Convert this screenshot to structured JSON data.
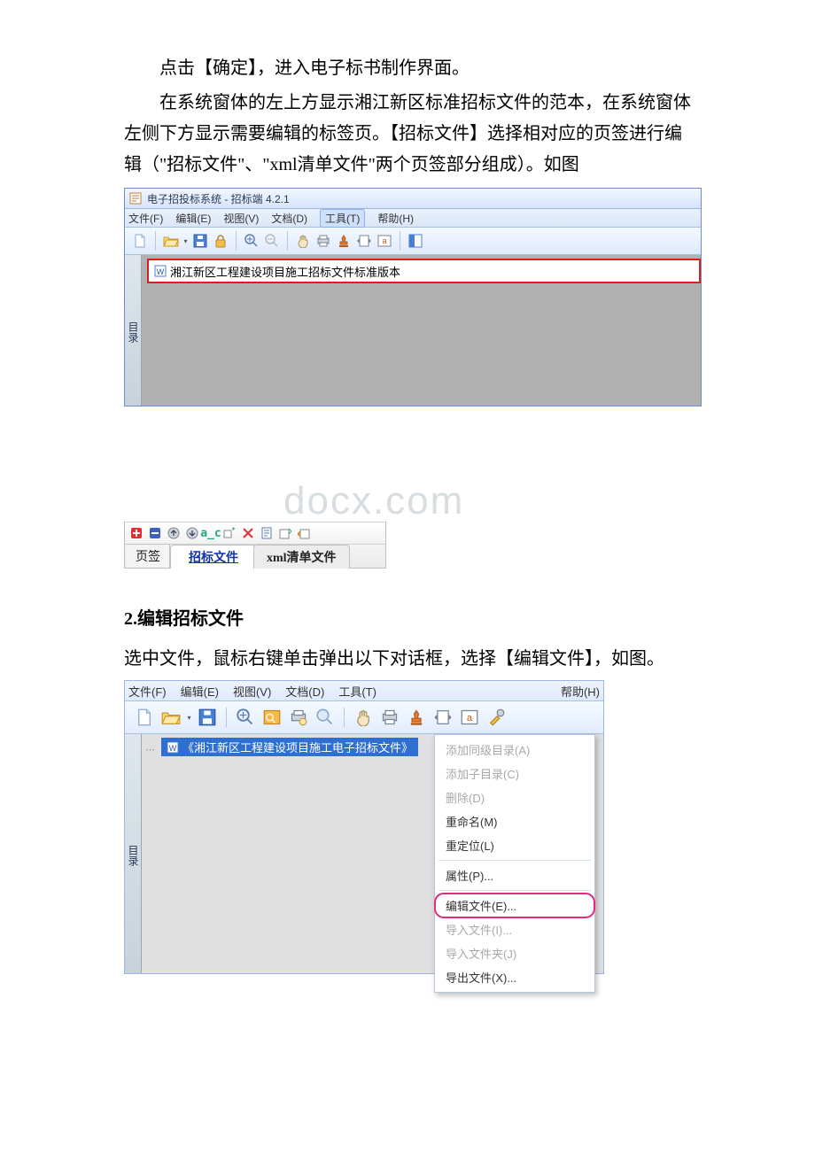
{
  "body": {
    "p1": "点击【确定】，进入电子标书制作界面。",
    "p2": "在系统窗体的左上方显示湘江新区标准招标文件的范本，在系统窗体左侧下方显示需要编辑的标签页。【招标文件】选择相对应的页签进行编辑（\"招标文件\"、\"xml清单文件\"两个页签部分组成）。如图",
    "h2": "2.编辑招标文件",
    "p3": "选中文件，鼠标右键单击弹出以下对话框，选择【编辑文件】，如图。"
  },
  "watermark": "docx.com",
  "win1": {
    "title": "电子招投标系统 - 招标端 4.2.1",
    "menus": {
      "file": "文件(F)",
      "edit": "编辑(E)",
      "view": "视图(V)",
      "doc": "文档(D)",
      "tool": "工具(T)",
      "help": "帮助(H)"
    },
    "mulu": "目录",
    "tree_item": "湘江新区工程建设项目施工招标文件标准版本",
    "tab_label": "页签",
    "tab_active": "招标文件",
    "tab_inactive": "xml清单文件"
  },
  "win2": {
    "menus": {
      "file": "文件(F)",
      "edit": "编辑(E)",
      "view": "视图(V)",
      "doc": "文档(D)",
      "tool": "工具(T)",
      "help": "帮助(H)"
    },
    "mulu": "目录",
    "selected_node": "《湘江新区工程建设项目施工电子招标文件》",
    "context_menu": {
      "add_sibling": "添加同级目录(A)",
      "add_child": "添加子目录(C)",
      "delete": "删除(D)",
      "rename": "重命名(M)",
      "relocate": "重定位(L)",
      "properties": "属性(P)...",
      "edit_file": "编辑文件(E)...",
      "import_file": "导入文件(I)...",
      "import_folder": "导入文件夹(J)",
      "export_file": "导出文件(X)..."
    }
  }
}
